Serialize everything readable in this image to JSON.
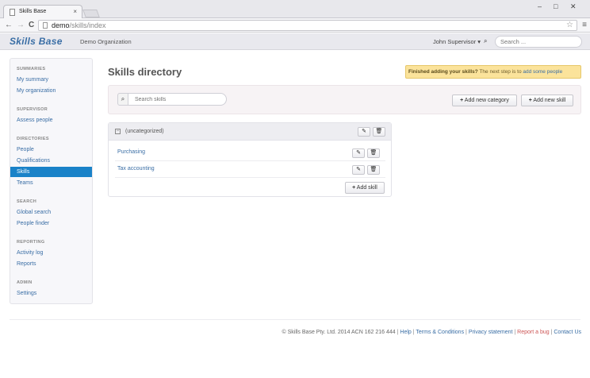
{
  "browser": {
    "tab_title": "Skills Base",
    "tab_close": "×",
    "url_host": "demo",
    "url_path": "/skills/index",
    "minimize": "–",
    "maximize": "□",
    "close": "✕",
    "back": "←",
    "forward": "→",
    "reload": "C",
    "star": "☆",
    "menu": "≡"
  },
  "header": {
    "logo": "Skills Base",
    "org": "Demo Organization",
    "user": "John Supervisor ▾",
    "search_icon": "⌕",
    "search_placeholder": "Search ..."
  },
  "sidebar": {
    "sections": [
      {
        "heading": "SUMMARIES",
        "items": [
          "My summary",
          "My organization"
        ]
      },
      {
        "heading": "SUPERVISOR",
        "items": [
          "Assess people"
        ]
      },
      {
        "heading": "DIRECTORIES",
        "items": [
          "People",
          "Qualifications",
          "Skills",
          "Teams"
        ]
      },
      {
        "heading": "SEARCH",
        "items": [
          "Global search",
          "People finder"
        ]
      },
      {
        "heading": "REPORTING",
        "items": [
          "Activity log",
          "Reports"
        ]
      },
      {
        "heading": "ADMIN",
        "items": [
          "Settings"
        ]
      }
    ],
    "active": "Skills"
  },
  "main": {
    "title": "Skills directory",
    "notice": {
      "bold": "Finished adding your skills?",
      "text": " The next step is to ",
      "link": "add some people"
    },
    "search_icon": "⌕",
    "search_placeholder": "Search skills",
    "add_category": "Add new category",
    "add_skill": "Add new skill",
    "plus": "+",
    "category": {
      "toggle": "−",
      "name": "(uncategorized)",
      "edit_icon": "✎",
      "delete_icon": "🗑",
      "skills": [
        "Purchasing",
        "Tax accounting"
      ],
      "add_skill": "Add skill"
    }
  },
  "footer": {
    "copyright": "© Skills Base Pty. Ltd. 2014 ACN 162 216 444",
    "links": [
      "Help",
      "Terms & Conditions",
      "Privacy statement",
      "Report a bug",
      "Contact Us"
    ],
    "separator": " | "
  }
}
